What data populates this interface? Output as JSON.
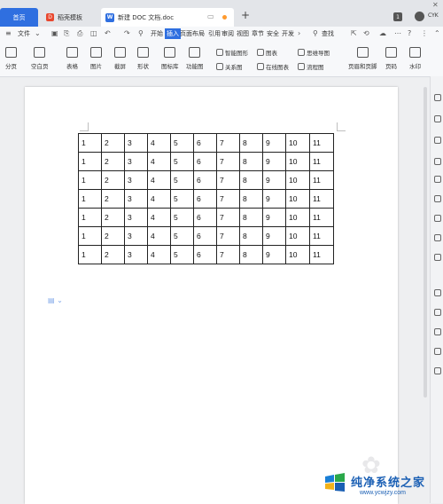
{
  "tabs": {
    "home": "首页",
    "template": "稻壳模板",
    "document": "新建 DOC 文档.doc",
    "add": "+"
  },
  "window": {
    "badge": "1",
    "user": "CYK"
  },
  "menu": {
    "file": "文件",
    "items": [
      "开始",
      "插入",
      "页面布局",
      "引用",
      "审阅",
      "视图",
      "章节",
      "安全",
      "开发"
    ],
    "active_index": 1,
    "search": "查找",
    "help": "?"
  },
  "ribbon": {
    "big": [
      "分页",
      "空白页",
      "表格",
      "图片",
      "截屏",
      "形状",
      "图标库",
      "功能图",
      "页眉和页脚",
      "页码",
      "水印"
    ],
    "small": [
      "智能图形",
      "图表",
      "思维导图",
      "关系图",
      "在线图表",
      "流程图"
    ]
  },
  "table": {
    "rows": [
      [
        "1",
        "2",
        "3",
        "4",
        "5",
        "6",
        "7",
        "8",
        "9",
        "10",
        "11"
      ],
      [
        "1",
        "2",
        "3",
        "4",
        "5",
        "6",
        "7",
        "8",
        "9",
        "10",
        "11"
      ],
      [
        "1",
        "2",
        "3",
        "4",
        "5",
        "6",
        "7",
        "8",
        "9",
        "10",
        "11"
      ],
      [
        "1",
        "2",
        "3",
        "4",
        "5",
        "6",
        "7",
        "8",
        "9",
        "10",
        "11"
      ],
      [
        "1",
        "2",
        "3",
        "4",
        "5",
        "6",
        "7",
        "8",
        "9",
        "10",
        "11"
      ],
      [
        "1",
        "2",
        "3",
        "4",
        "5",
        "6",
        "7",
        "8",
        "9",
        "10",
        "11"
      ],
      [
        "1",
        "2",
        "3",
        "4",
        "5",
        "6",
        "7",
        "8",
        "9",
        "10",
        "11"
      ]
    ]
  },
  "brand": {
    "name": "纯净系统之家",
    "url": "www.ycwjzy.com"
  },
  "colors": {
    "accent": "#2f6fe0",
    "modified_dot": "#ff9a2e",
    "brand": "#1a5fb4"
  }
}
